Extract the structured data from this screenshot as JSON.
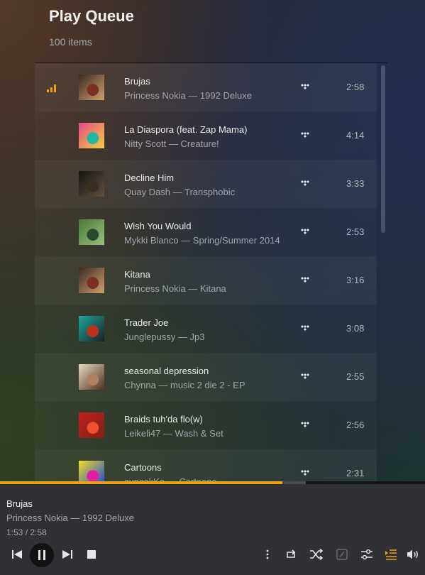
{
  "header": {
    "title": "Play Queue",
    "count": "100 items"
  },
  "queue": [
    {
      "title": "Brujas",
      "subtitle": "Princess Nokia — 1992 Deluxe",
      "duration": "2:58",
      "playing": true,
      "art": [
        "#3a2a20",
        "#7a3020",
        "#d0a070"
      ]
    },
    {
      "title": "La Diaspora (feat. Zap Mama)",
      "subtitle": "Nitty Scott — Creature!",
      "duration": "4:14",
      "playing": false,
      "art": [
        "#e84a8a",
        "#20b8a0",
        "#f0d040"
      ]
    },
    {
      "title": "Decline Him",
      "subtitle": "Quay Dash — Transphobic",
      "duration": "3:33",
      "playing": false,
      "art": [
        "#151510",
        "#3a3020",
        "#605040"
      ]
    },
    {
      "title": "Wish You Would",
      "subtitle": "Mykki Blanco — Spring/Summer 2014",
      "duration": "2:53",
      "playing": false,
      "art": [
        "#4a7a3a",
        "#2a4a2a",
        "#9ac080"
      ]
    },
    {
      "title": "Kitana",
      "subtitle": "Princess Nokia — Kitana",
      "duration": "3:16",
      "playing": false,
      "art": [
        "#3a2a20",
        "#7a3020",
        "#d0a070"
      ]
    },
    {
      "title": "Trader Joe",
      "subtitle": "Junglepussy — Jp3",
      "duration": "3:08",
      "playing": false,
      "art": [
        "#18a8a0",
        "#c03020",
        "#202020"
      ]
    },
    {
      "title": "seasonal depression",
      "subtitle": "Chynna — music 2 die 2 - EP",
      "duration": "2:55",
      "playing": false,
      "art": [
        "#e8d8c0",
        "#b08060",
        "#503020"
      ]
    },
    {
      "title": "Braids tuh'da flo(w)",
      "subtitle": "Leikeli47 — Wash & Set",
      "duration": "2:56",
      "playing": false,
      "art": [
        "#c02020",
        "#f05030",
        "#802010"
      ]
    },
    {
      "title": "Cartoons",
      "subtitle": "cupcakKe — Cartoons",
      "duration": "2:31",
      "playing": false,
      "art": [
        "#f0e020",
        "#e020a0",
        "#2040e0"
      ]
    }
  ],
  "now_playing": {
    "title": "Brujas",
    "subtitle": "Princess Nokia — 1992 Deluxe",
    "time": "1:53 / 2:58",
    "progress": 0.665,
    "buffered": 0.72
  },
  "controls": [
    "previous-icon",
    "pause-icon",
    "next-icon",
    "stop-icon",
    "more-icon",
    "repeat-icon",
    "shuffle-icon",
    "lyrics-icon",
    "equalizer-icon",
    "queue-icon",
    "volume-icon"
  ],
  "colors": {
    "accent": "#e8a317",
    "player_bg": "#2f3134"
  }
}
